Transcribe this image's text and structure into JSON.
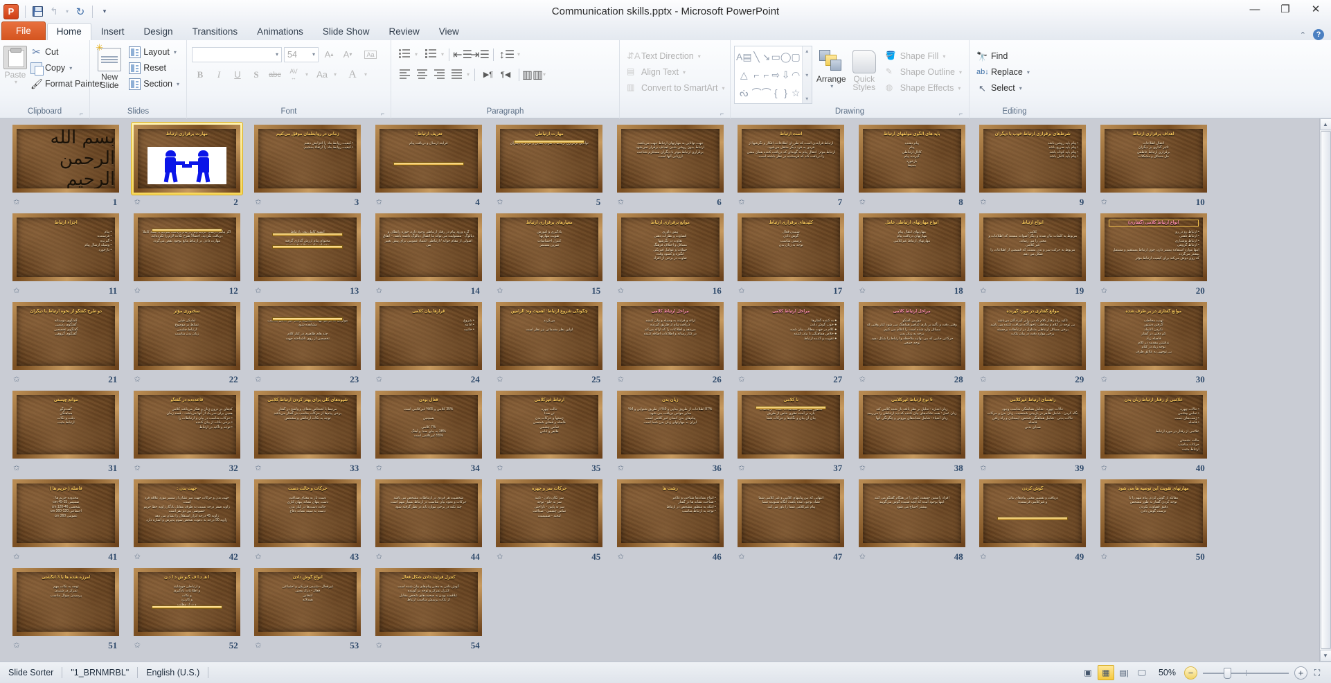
{
  "window": {
    "title": "Communication skills.pptx  -  Microsoft PowerPoint",
    "minimize_label": "—",
    "restore_label": "❐",
    "close_label": "✕"
  },
  "quick_access": {
    "app_logo": "P",
    "items": [
      {
        "name": "save",
        "label": "save-icon"
      },
      {
        "name": "undo",
        "label": "↺"
      },
      {
        "name": "undo-dropdown",
        "label": "▾"
      },
      {
        "name": "redo",
        "label": "↻"
      },
      {
        "name": "customize",
        "label": "▾"
      }
    ]
  },
  "tabs": [
    {
      "label": "File",
      "type": "file"
    },
    {
      "label": "Home",
      "type": "active"
    },
    {
      "label": "Insert",
      "type": "normal"
    },
    {
      "label": "Design",
      "type": "normal"
    },
    {
      "label": "Transitions",
      "type": "normal"
    },
    {
      "label": "Animations",
      "type": "normal"
    },
    {
      "label": "Slide Show",
      "type": "normal"
    },
    {
      "label": "Review",
      "type": "normal"
    },
    {
      "label": "View",
      "type": "normal"
    }
  ],
  "ribbon": {
    "help_icon": "?",
    "collapse_icon": "⌃",
    "clipboard": {
      "label": "Clipboard",
      "paste": "Paste",
      "cut": "Cut",
      "copy": "Copy",
      "format_painter": "Format Painter"
    },
    "slides": {
      "label": "Slides",
      "new_slide_line1": "New",
      "new_slide_line2": "Slide",
      "layout": "Layout",
      "reset": "Reset",
      "section": "Section"
    },
    "font": {
      "label": "Font",
      "font_name_value": "",
      "font_name_placeholder": "",
      "font_size_value": "54",
      "grow_font": "A",
      "shrink_font": "A",
      "clear_formatting": "Aa",
      "bold": "B",
      "italic": "I",
      "underline": "U",
      "shadow": "S",
      "strikethrough": "abc",
      "character_spacing": "AV",
      "change_case": "Aa",
      "font_color": "A"
    },
    "paragraph": {
      "label": "Paragraph",
      "bullets": "Bullets",
      "numbering": "Numbering",
      "decrease_indent": "Decrease List Level",
      "increase_indent": "Increase List Level",
      "line_spacing": "Line Spacing",
      "align_left": "Align Text Left",
      "align_center": "Center",
      "align_right": "Align Text Right",
      "justify": "Justify",
      "ltr": "Left-to-Right",
      "rtl": "Right-to-Left",
      "columns": "Columns",
      "text_direction": "Text Direction",
      "align_text": "Align Text",
      "convert_to_smartart": "Convert to SmartArt"
    },
    "drawing": {
      "label": "Drawing",
      "shapes": [
        "A▤",
        "╲",
        "↘",
        "▭",
        "◯",
        "▢",
        "△",
        "⌐",
        "⌐",
        "⇨",
        "⇩",
        "◠",
        "ᔔ",
        "⌒",
        "⌒",
        "{",
        "}",
        "☆"
      ],
      "scroll_up": "▴",
      "scroll_down": "▾",
      "scroll_more": "▾",
      "arrange": "Arrange",
      "quick_styles_line1": "Quick",
      "quick_styles_line2": "Styles",
      "shape_fill": "Shape Fill",
      "shape_outline": "Shape Outline",
      "shape_effects": "Shape Effects"
    },
    "editing": {
      "label": "Editing",
      "find": "Find",
      "replace": "Replace",
      "select": "Select"
    }
  },
  "statusbar": {
    "view_name": "Slide Sorter",
    "theme_name": "\"1_BRNMRBL\"",
    "language": "English (U.S.)",
    "zoom_level": "50%",
    "zoom_out": "−",
    "zoom_in": "+",
    "views": [
      {
        "name": "normal-view",
        "glyph": "▣",
        "active": false
      },
      {
        "name": "slide-sorter-view",
        "glyph": "▦",
        "active": true
      },
      {
        "name": "reading-view",
        "glyph": "📖",
        "active": false
      },
      {
        "name": "slide-show-view",
        "glyph": "🖵",
        "active": false
      }
    ],
    "fit_to_window": "⛶"
  },
  "slides": [
    {
      "n": 1,
      "kind": "calligraphy",
      "title": "",
      "calligraphy": "بسم الله الرحمن الرحیم"
    },
    {
      "n": 2,
      "kind": "handshake",
      "title": "مهارت برقراری ارتباط",
      "selected": true
    },
    {
      "n": 3,
      "kind": "text",
      "title": "زمانی در روابطمان موفق می‌کنیم",
      "body": "• کیفیت روابط ماد را افزایش دهیم\n• کیفیت روابط ماد را ارتقاء بخشیم."
    },
    {
      "n": 4,
      "kind": "bar",
      "title": "تعریف ارتباط :",
      "body": "فرآیند ارسال و دریافت پیام"
    },
    {
      "n": 5,
      "kind": "bar2",
      "title": "مهارت ارتباطی",
      "body": "توانایی برقراری ارتباط با طرف مقابل و فراتر با دیگران"
    },
    {
      "n": 6,
      "kind": "text",
      "title": "",
      "body": "جهت توانایی به مهارتهای ارتباط جهت می‌باشد.\nارتباط بدون روشن شدن اهداف برقرار نمی‌شود\nبرقراری ارتباط موثر با دیگران مستلزم شناخت\nارزیابی آنها است."
    },
    {
      "n": 7,
      "kind": "text",
      "title": "است ارتباط",
      "body": "ارتباط فرایندی است که طی آن اطلاعات، افکار و نگرشها از فردی به فرد دیگر منتقل می‌شود.\nارتباط موثر: انتقال پیام به گونه‌ای که دریافت کننده همان معنی را دریافت کند که فرستنده در نظر داشته است."
    },
    {
      "n": 8,
      "kind": "text",
      "title": "باید های الگوی مولفهای ارتباط",
      "body": "پیام دهنده\nپیام\nکانال ارتباطی\nگیرنده پیام\nبازخورد\nمحیط"
    },
    {
      "n": 9,
      "kind": "text",
      "title": "شرط‌های برقراری ارتباط خوب با دیگران",
      "body": "• پیام باید روشن باشد\n• پیام باید صریح باشد\n• پیام باید کوتاه باشد\n• پیام باید کامل باشد"
    },
    {
      "n": 10,
      "kind": "text",
      "title": "اهداف برقراری ارتباط",
      "body": "انتقال اطلاعات\nتاثیر گذاری بر دیگران\nبرقراری ارتباط عاطفی\nحل مسائل و مشکلات"
    },
    {
      "n": 11,
      "kind": "text",
      "title": "اجزاء ارتباط",
      "body": "• پیام\n• فرستنده\n• گیرنده\n• وسیله ارسال پیام\n• بازخورد"
    },
    {
      "n": 12,
      "kind": "bar2",
      "title": "",
      "body": "اگر پیامی ارسال کردید ولی از پیام دریافت نکردید یا اینکه کاملاً دریافت نکردید، احتمالاً طرح نکات لازم را نکرده‌اید.\nمهارت دادن در ارتباط مانع بوجود نقص می‌گردد"
    },
    {
      "n": 13,
      "kind": "bar3",
      "title": "",
      "body": "انسیه کامل بودن ارتباط\n\nمحتوای پیام ارزش گذاری گرفته\nمحتوای پیام نیز دقیق فرستنده"
    },
    {
      "n": 14,
      "kind": "text",
      "title": "",
      "body": "گره ورود پیام در رفتار ارتباطی وجود دارد، حوزه رابطان و دیالوگ - مسئولیت می تواند ما اتصال دیالوگ داشته باشد. - اتفاق\nاصولی از مقام جوانه / ارتباطی اعتماد عمومی برای پیش تغییر می"
    },
    {
      "n": 15,
      "kind": "text",
      "title": "معیارهای برقراری ارتباط",
      "body": "یادگیری و آموزش\nتقویت مهارتها\nکنترل احساسات\nتمرین مستمر"
    },
    {
      "n": 16,
      "kind": "text",
      "title": "موانع برقراری ارتباط",
      "body": "پیش داوری\nقضاوت و نظرات ذهنی\nتفاوت در نگرشها\nمسائل و اختلاف فرهنگ\nجملات و عوامل فیزیکی\nانگیزه و کمبود وقت\nتفاوت در برخی از افراد"
    },
    {
      "n": 17,
      "kind": "text",
      "title": "کلیدهای برقراری ارتباط",
      "body": "شنیدن فعال\nگوش دادن\nپرسش مناسب\nتوجه به زبان بدن"
    },
    {
      "n": 18,
      "kind": "text",
      "title": "انواع مهارتهای ارتباطی عامل",
      "body": "مهارتهای انتقال پیام\nمهارتهای دریافت پیام\nمهارتهای ارتباط غیرکلامی"
    },
    {
      "n": 19,
      "kind": "text",
      "title": "انواع ارتباط",
      "body": "کلامی\nمربوط به کلمات بیان شده و دیگر اصوات مستند که اطلاعات و معنی را می رساند.\nغیر کلامی\nمربوط به حرکت سر و بدن مستند که قسمتی از اطلاعات را شکل می دهد."
    },
    {
      "n": 20,
      "kind": "highlight",
      "title": "انواع ارتباط کلامی (گفتاری)",
      "body": "• ارتباط رو در رو\n• ارتباط تلفنی\n• ارتباط نوشتاری\n• ارتباط گروهی\nاینها موارد استفاده بیشتر دارد، چون ارتباط مستقیم و مستقل بیشتر می‌گردد\nکه روی دوش می‌کند برای کیفیت ارتباط مؤثر"
    },
    {
      "n": 21,
      "kind": "text",
      "title": "دو طرح گفتگو از نحوه ارتباط با دیگران",
      "body": "گفتگوی دوستانه\nگفتگوی رسمی\nگفتگوی تخصصی\nگفتگوی گروهی"
    },
    {
      "n": 22,
      "kind": "text",
      "title": "سخنوری مؤثر",
      "body": "آمادگی قبلی\nتسلط بر موضوع\nارتباط چشمی\nزبان بدن مناسب"
    },
    {
      "n": 23,
      "kind": "bar2",
      "title": "",
      "body": "مواردی که در مواجهه با انسان‌ها رفتار غیر کلامی مناسب مشاهده شود\n\nچند های ظاهری در کنار کلام\nتخصصی از روی ناشناخته جهت"
    },
    {
      "n": 24,
      "kind": "text",
      "title": "قرارها بیان کلامی",
      "body": "• شروع\n• ادامه\n• خاتمه"
    },
    {
      "n": 25,
      "kind": "text",
      "title": "چگونگی شروع ارتباط: اهمیت وند الزامین",
      "body": "می‌گردد\n\nاولین نظر مقدماتی نیز نظر است"
    },
    {
      "n": 26,
      "kind": "text",
      "title": "مراحل ارتباط کلامی",
      "body": "ارائه و فرآیند به وسیله و بیان کننده.\nدریافت پیام از طریق گیرنده\nمی‌دهد و اطلاعات را که ارائه می‌کند\nدر کنار رسانه و اطلاعات اضافه کننده"
    },
    {
      "n": 27,
      "kind": "text",
      "title": "مراحل ارتباط کلامی",
      "body": "● به کننده گفتارها\n● خوب گوش دادن\n● کلام در جهت مطالب بیان شده\n● خلاص هماهنگی با بیان کننده\n● تقویت و کننده ارتباط"
    },
    {
      "n": 28,
      "kind": "text",
      "title": "مراحل ارتباط کلامی",
      "body": "دوربین گفتگو\nوقتی دقت و تأکید بر بازی عناصر هماهنگ می شود کنار وقتی که مسائل وارد شده است را اعلام می کنیم.\nبرخه به زبان بدن\nحرکاتی جانبی که می توانید ملاحظه و ارتباط را شکل دهید.\nتوجه جمعی"
    },
    {
      "n": 29,
      "kind": "text",
      "title": "موانع گفتاری در مورد گیرنده",
      "body": "تأکید زیاد رفتار کلام که در برابر گیرندگان می‌باشد\nبی توجه در کلام و مخاطب ناخودآگاه دریافت کننده می باشد\nبرخی مسائل ارتباطی متداول در ارتباطات برجسته\nبرخی موارد دقت در بیان نکات"
    },
    {
      "n": 30,
      "kind": "text",
      "title": "موانع گفتاری در بر طرف شده",
      "body": "تهدید مخاطب\nگرفتن دستور\nنکردن اعتماد\nکم دقتی در گفتار\nفاصله زیاد\nنداشتن مقدمه در کلام\nتوجه زیاد در کلام\nبی توجهی به علائق طرف"
    },
    {
      "n": 31,
      "kind": "text",
      "title": "موانع چیستی",
      "body": "گفت‌وگو\nهماهنگی\nدقت و نکات\nارتباط مثبت"
    },
    {
      "n": 32,
      "kind": "text",
      "title": "قاعده‌ده در گفتگو",
      "body": "کدهای در درون زبان و تفکر می‌باشد کلامی\nهمین برای سر یک از آنها می‌باشد. - قصد زمان\n• حرکات مناسب در بیان و ارتباطات را\n• برخی نکات از بیان کننده\n• توجه و تأکید در ارتباط"
    },
    {
      "n": 33,
      "kind": "text",
      "title": "شیوه‌های کلی برای بهتر کردن ارتباط کلامی",
      "body": "مرتبط با اشخاص شفاف و واضح در گفتار\nبرخی پیام‌ها از حرکات مناسب در گفتار می‌باشد\nتوجه به نکات ارتباطی و مشخص"
    },
    {
      "n": 34,
      "kind": "text",
      "title": "فعال بودن",
      "body": "35% کلامی و 65% غیرکلامی است\n\nهمچنین\n\n7% کلامی\n38% به جای صدا و آهنگ\n55% غیرکلامی است"
    },
    {
      "n": 35,
      "kind": "text",
      "title": "ارتباط غیرکلامی",
      "body": "حالت چهره\nتن صدا\nژستها و حرکات بدن\nفاصله و فضای شخصی\nتماس چشمی\nظاهر و لباس"
    },
    {
      "n": 36,
      "kind": "text",
      "title": "زبان بدن",
      "body": "87% اطلاعات از طریق بینایی و 9% از طریق شنوایی و 4% سایر حواس دریافت می شود.\nپیام‌های بدن انسان غیر کلامی است.\nایران به مهارتهای زبان بدن شما است"
    },
    {
      "n": 37,
      "kind": "bar2",
      "title": "نا کلامی",
      "body": "منظور هماهنگ‌تر مشاهدات است - ارتباطات\nباره بر آمده نظری خاص از طریق\nبیان آن بیان و نگاه‌ها و حرکات شما"
    },
    {
      "n": 38,
      "kind": "text",
      "title": "5 نوع ارتباط غیرکلامی",
      "body": "زبان اشاره : تحلیل بر نظر یافته باز شده کلامی کند\nزبان عمل : همه نشانه‌های بیان کننده که دید ارتباطی را می‌رسد\nزبان اشیاء : شامل نشانه‌های بیرونی و چگونگی آنها"
    },
    {
      "n": 39,
      "kind": "text",
      "title": "راهنمای ارتباط غیرکلامی",
      "body": "حالات چهره - شامل هماهنگی مناسب وجود\nنگاه کردن - شامل ظاهر در بازبینی شخصیت، زبان بدن و حرکات\nحالات بدنی - شامل هماهنگی شخص، ایستادن و راه رفتن\nفاصله\nصدای بدنی"
    },
    {
      "n": 40,
      "kind": "text",
      "title": "علائمی از رفتار ارتباط زبان بدن",
      "body": "• حالات چهره\n• تماس چشمی\n• ژست‌های دست\n• فاصله\n\nعلائمی از رفتار در مورد ارتباط\n\nحالت نشستن\nحرکات مناسب\nارتباط مثبت"
    },
    {
      "n": 41,
      "kind": "text",
      "title": "فاصله ( حریم ها )",
      "body": "محدوده حریم ها :\nصمیمی 15-45 cm\nشخصی 46-120 cm\nاجتماعی 120-360 cm\nعمومی 360 cm"
    },
    {
      "n": 42,
      "kind": "text",
      "title": "جهت بدن :",
      "body": "جهت بدن و حرکات جهت سر نشان از مسیر مورد علاقه فرد است.\nزاویه صفر درجه نسبت به طرف مقابل یادگار زاویه خط حریم خصوصی بین دو نفر است\nزاویه 45 درجه ابراز استقلال را نشان می دهد\nزاویه 90 درجه به دعوت شخص سوم پذیرش و اشاره دارد"
    },
    {
      "n": 43,
      "kind": "text",
      "title": "حرکات و حالت دست",
      "body": "دست باز به معنای صداقت\nدست پنهان نشانه پنهان کاری\nحالت دست‌ها در کنار بدن\nدست به سینه نشانه دفاع"
    },
    {
      "n": 44,
      "kind": "text",
      "title": "",
      "body": "شخصیت هر فردی در ارتباطات مشخص می باشد\nحرکات و نحوه بیان مناسب در ارتباط بسیار مهم است\nچند نکته در برخی موارد باید در نظر گرفته شود"
    },
    {
      "n": 45,
      "kind": "text",
      "title": "حرکات سر و چهره",
      "body": "سر تکان دادن - تایید\nسر به جلو - توجه\nسر به پایین - ناراحتی\nتماس چشمی - صداقت\nلبخند - صمیمیت"
    },
    {
      "n": 46,
      "kind": "text",
      "title": "رشت ها",
      "body": "• انواع نشانه‌ها شناخت و علائم\n• شناخت نشانه ها در گفتار\n• اینکه به منظور مشخص در ارتباط\n• توجه به ارتباط مناسب"
    },
    {
      "n": 47,
      "kind": "text",
      "title": "",
      "body": "انتهایی که بین پیامهای کلامی و غیر کلامی شما\nتضاد بوجود آمده باشد، آنگاه شنونده شما\nپیام غیرکلامی شما را باور می کند."
    },
    {
      "n": 48,
      "kind": "text",
      "title": "",
      "body": "افراد راستین حقیقت کمتر را در هنگام گفتگو می کنند\nاینها بوجود آمده که آنچه شنیده گوش می‌گویند\nبیشتر احتیاج می شود"
    },
    {
      "n": 49,
      "kind": "bar",
      "title": "گوش کردن",
      "body": "دریافت و تفسیر معنی پیام‌های بیانی\nو غیرکلامی فرستنده"
    },
    {
      "n": 50,
      "kind": "text",
      "title": "مهارتهای تقویت این توصیه ها می شود",
      "body": "مقابله از گوش کردن پیام مهم را با\nتوجه کردن گفتار به طور مشخص\nدقیق قضاوت نکردن\nدرست گوش دادن"
    },
    {
      "n": 51,
      "kind": "text",
      "title": "آمرزه شده ها با 3 انگشتی",
      "body": "توجه به نکات مهم\nتمرکز در شنیدن\nپرسیدن سوال مناسب"
    },
    {
      "n": 52,
      "kind": "bar",
      "title": "ا هـ د ا ف گـو ش د ا د ن",
      "body": "و ارتباطی خوشایند\nو اطلاعات یادگیری\nو نکات\nو کاربرد\nو درک مطلب"
    },
    {
      "n": 53,
      "kind": "text",
      "title": "انواع گوش دادن",
      "body": "غیرفعال - شنیدن فیزیکی و اجتماعی\nفعال - درک معنی\nانتخابی\nهمدلانه"
    },
    {
      "n": 54,
      "kind": "text",
      "title": "کنترل فرآیند دادن شکل فعال",
      "body": "گوش دادن به معنی پیام‌های بیان شده است\nکنترل تمرکز و توجه بر گوینده\nعلاقمند بودن به صحبت‌های شخص مقابل\nاز نکات پرسش مناسب ارتباط"
    }
  ]
}
